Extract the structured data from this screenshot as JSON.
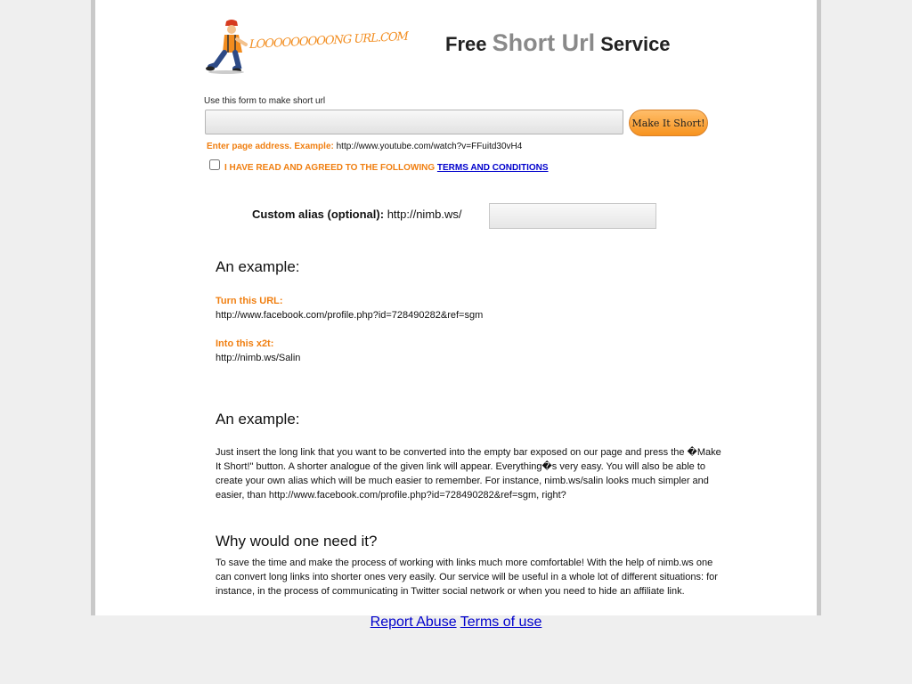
{
  "header": {
    "logo_text": "LOOOOOOOOONG URL.COM",
    "title_prefix": "Free",
    "title_middle": "Short Url",
    "title_suffix": "Service"
  },
  "form": {
    "caption": "Use this form to make short url",
    "url_input_value": "",
    "submit_label": "Make It Short!",
    "hint_label": "Enter page address. Example:",
    "hint_example": "http://www.youtube.com/watch?v=FFuitd30vH4",
    "terms_text": "I HAVE READ AND AGREED TO THE FOLLOWING",
    "terms_link": "TERMS AND CONDITIONS",
    "terms_checked": false,
    "alias_label": "Custom alias (optional):",
    "alias_prefix": "http://nimb.ws/",
    "alias_value": ""
  },
  "example": {
    "heading": "An example:",
    "from_label": "Turn this URL:",
    "from_url": "http://www.facebook.com/profile.php?id=728490282&ref=sgm",
    "to_label": "Into this x2t:",
    "to_url": "http://nimb.ws/Salin"
  },
  "example2": {
    "heading": "An example:",
    "text": "Just insert the long link that you want to be converted into the empty bar exposed on our page and press the �Make It Short!\" button. A shorter analogue of the given link will appear. Everything�s very easy. You will also be able to create your own alias which will be much easier to remember. For instance, nimb.ws/salin looks much simpler and easier, than http://www.facebook.com/profile.php?id=728490282&ref=sgm, right?"
  },
  "why": {
    "heading": "Why would one need it?",
    "text": "To save the time and make the process of working with links much more comfortable! With the help of nimb.ws one can convert long links into shorter ones very easily. Our service will be useful in a whole lot of different situations: for instance, in the process of communicating in Twitter social network or when you need to hide an affiliate link."
  },
  "footer": {
    "report_abuse": "Report Abuse",
    "terms_of_use": "Terms of use"
  },
  "colors": {
    "accent_orange": "#f07f11",
    "link_blue": "#0000cc",
    "button_orange": "#f7931e"
  }
}
